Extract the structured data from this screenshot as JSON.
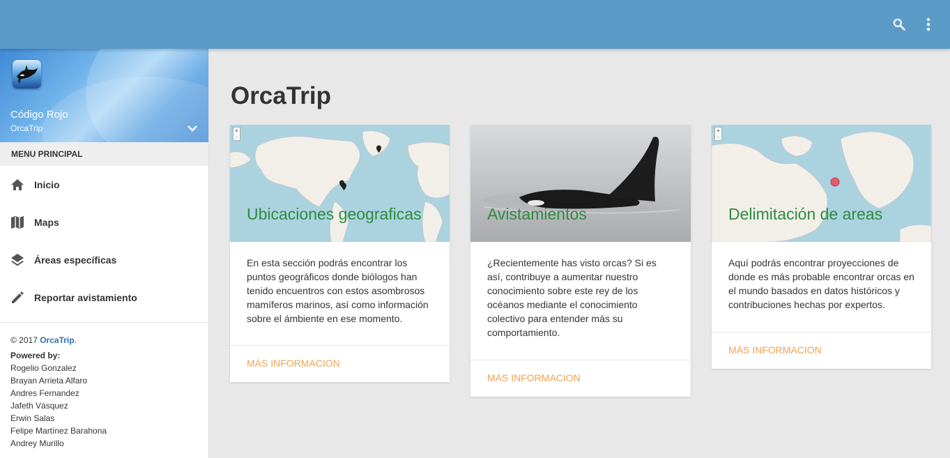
{
  "topbar": {
    "search_icon": "search-icon",
    "more_icon": "more-vert-icon",
    "color": "#5b9bc8"
  },
  "sidebar": {
    "title": "Código Rojo",
    "subtitle": "OrcaTrip",
    "menu_heading": "MENU PRINCIPAL",
    "items": [
      {
        "label": "Inicio",
        "icon": "home-icon"
      },
      {
        "label": "Maps",
        "icon": "map-icon"
      },
      {
        "label": "Áreas específicas",
        "icon": "layers-icon"
      },
      {
        "label": "Reportar avistamiento",
        "icon": "pencil-icon"
      }
    ],
    "footer": {
      "copyright": "© 2017",
      "brand": "OrcaTrip",
      "period": ".",
      "powered_by": "Powered by:",
      "authors": [
        "Rogelio Gonzalez",
        "Brayan Arrieta Alfaro",
        "Andres Fernandez",
        "Jafeth Vásquez",
        "Erwin Salas",
        "Felipe Martínez Barahona",
        "Andrey Murillo"
      ]
    }
  },
  "main": {
    "title": "OrcaTrip",
    "cards": [
      {
        "title": "Ubicaciones geograficas",
        "text": "En esta sección podrás encontrar los puntos geográficos donde biólogos han tenido encuentros con estos asombrosos mamíferos marinos, así como información sobre el ámbiente en ese momento.",
        "action": "MÁS INFORMACION"
      },
      {
        "title": "Avistamientos",
        "text": "¿Recientemente has visto orcas? Si es así, contribuye a aumentar nuestro conocimiento sobre este rey de los océanos mediante el conocimiento colectivo para entender más su comportamiento.",
        "action": "MÁS INFORMACION"
      },
      {
        "title": "Delimitación de areas",
        "text": "Aquí podrás encontrar proyecciones de donde es más probable encontrar orcas en el mundo basados en datos históricos y contribuciones hechas por expertos.",
        "action": "MÁS INFORMACION"
      }
    ],
    "map_zoom": {
      "in": "+",
      "out": "-"
    }
  },
  "colors": {
    "accent": "#f2a24e",
    "card_title": "#2e8b3f",
    "link": "#2f6eb5"
  }
}
